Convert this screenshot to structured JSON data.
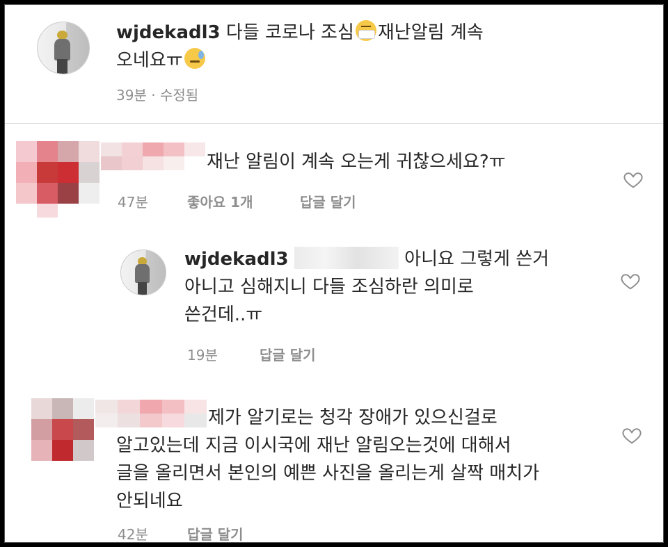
{
  "post": {
    "username": "wjdekadl3",
    "caption_part1": "다들 코로나 조심",
    "emoji1": "mask-face-emoji",
    "caption_part2": "재난알림 계속",
    "caption_line2": "오네요ㅠ",
    "emoji2": "sweat-face-emoji",
    "time": "39분",
    "separator": "·",
    "edited": "수정됨"
  },
  "comments": [
    {
      "text": "재난 알림이 계속 오는게 귀찮으세요?ㅠ",
      "time": "47분",
      "likes": "좋아요 1개",
      "reply_label": "답글 달기",
      "heart_icon": "heart-outline-icon"
    },
    {
      "username": "wjdekadl3",
      "text_line1": "아니요 그렇게 쓴거",
      "text_line2": "아니고 심해지니 다들 조심하란 의미로",
      "text_line3": "쓴건데..ㅠ",
      "time": "19분",
      "reply_label": "답글 달기",
      "heart_icon": "heart-outline-icon"
    },
    {
      "text_line1": "제가 알기로는 청각 장애가 있으신걸로",
      "text_line2": "알고있는데  지금 이시국에 재난 알림오는것에 대해서",
      "text_line3": "글을 올리면서 본인의 예쁜 사진을 올리는게 살짝 매치가",
      "text_line4": "안되네요",
      "time": "42분",
      "reply_label": "답글 달기",
      "heart_icon": "heart-outline-icon"
    }
  ],
  "colors": {
    "text": "#262626",
    "meta": "#8e8e8e",
    "divider": "#dbdbdb",
    "frame": "#000000"
  }
}
